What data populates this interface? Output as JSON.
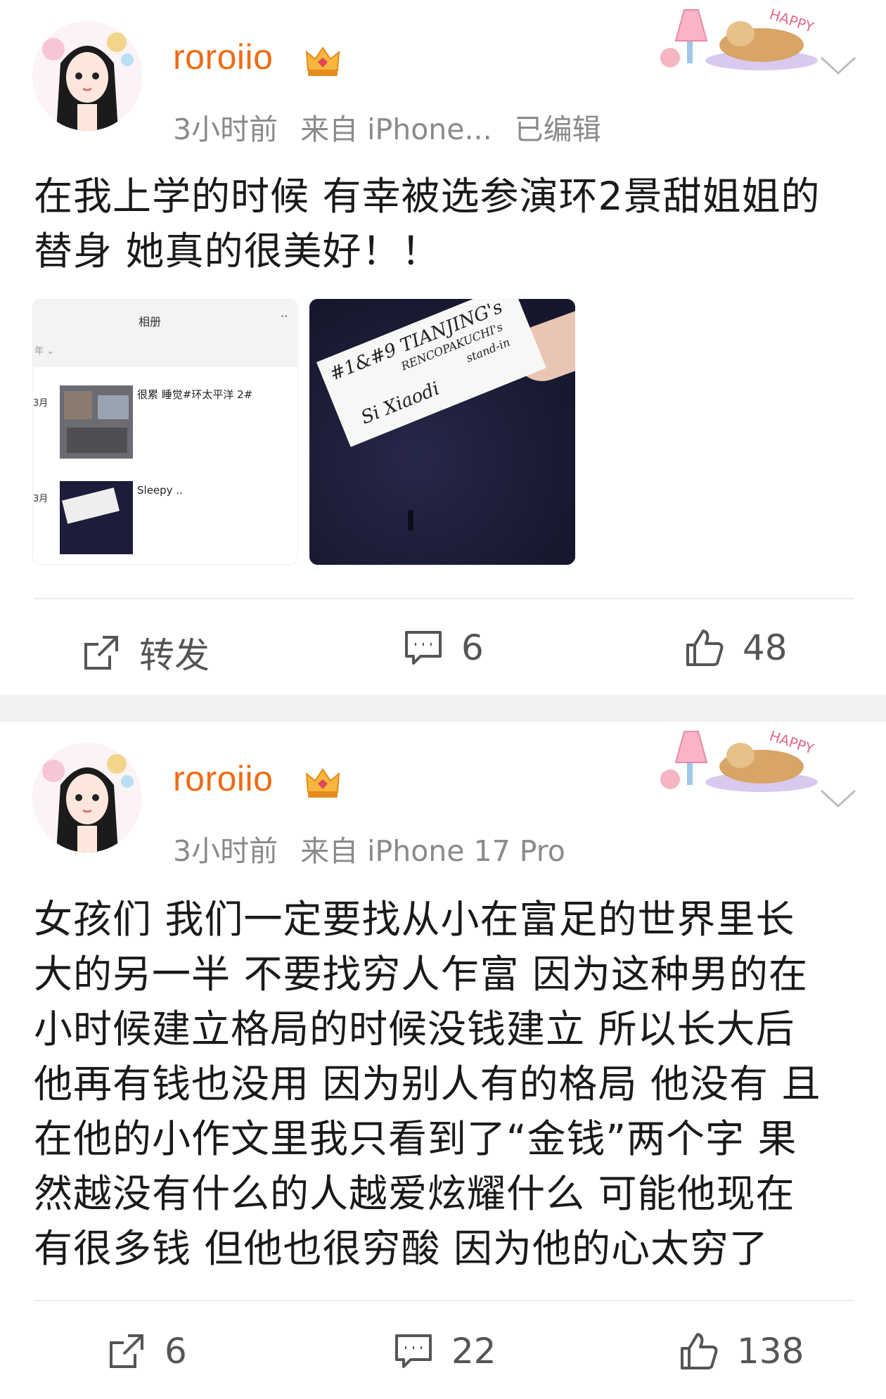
{
  "posts": [
    {
      "username": "roroiio",
      "time": "3小时前",
      "source": "来自 iPhone...",
      "edited": "已编辑",
      "text_lines": [
        "在我上学的时候 有幸被选参演环2景甜姐姐的",
        "替身 她真的很美好！！"
      ],
      "left_image": {
        "title": "相册",
        "menu": "··",
        "filter": "年 ⌄",
        "rows": [
          {
            "month": "3月",
            "caption": "很累 睡觉#环太平洋 2#"
          },
          {
            "month": "3月",
            "caption": "Sleepy .."
          }
        ]
      },
      "right_image": {
        "lines": [
          "#1&#9 TIANJING's",
          "RENCOPAKUCHI's",
          "stand-in",
          "Si Xiaodi"
        ]
      },
      "actions": {
        "repost": "转发",
        "comment": "6",
        "like": "48"
      }
    },
    {
      "username": "roroiio",
      "time": "3小时前",
      "source": "来自 iPhone 17 Pro",
      "text_lines": [
        "女孩们 我们一定要找从小在富足的世界里长",
        "大的另一半 不要找穷人乍富 因为这种男的在",
        "小时候建立格局的时候没钱建立 所以长大后",
        "他再有钱也没用 因为别人有的格局 他没有 且",
        "在他的小作文里我只看到了“金钱”两个字 果",
        "然越没有什么的人越爱炫耀什么 可能他现在",
        "有很多钱 但他也很穷酸 因为他的心太穷了"
      ],
      "actions": {
        "repost": "6",
        "comment": "22",
        "like": "138"
      }
    }
  ],
  "decor_text": "HAPPY",
  "colors": {
    "username": "#f06b12",
    "meta": "#8a8a8a",
    "separator": "#f1f1f2"
  }
}
